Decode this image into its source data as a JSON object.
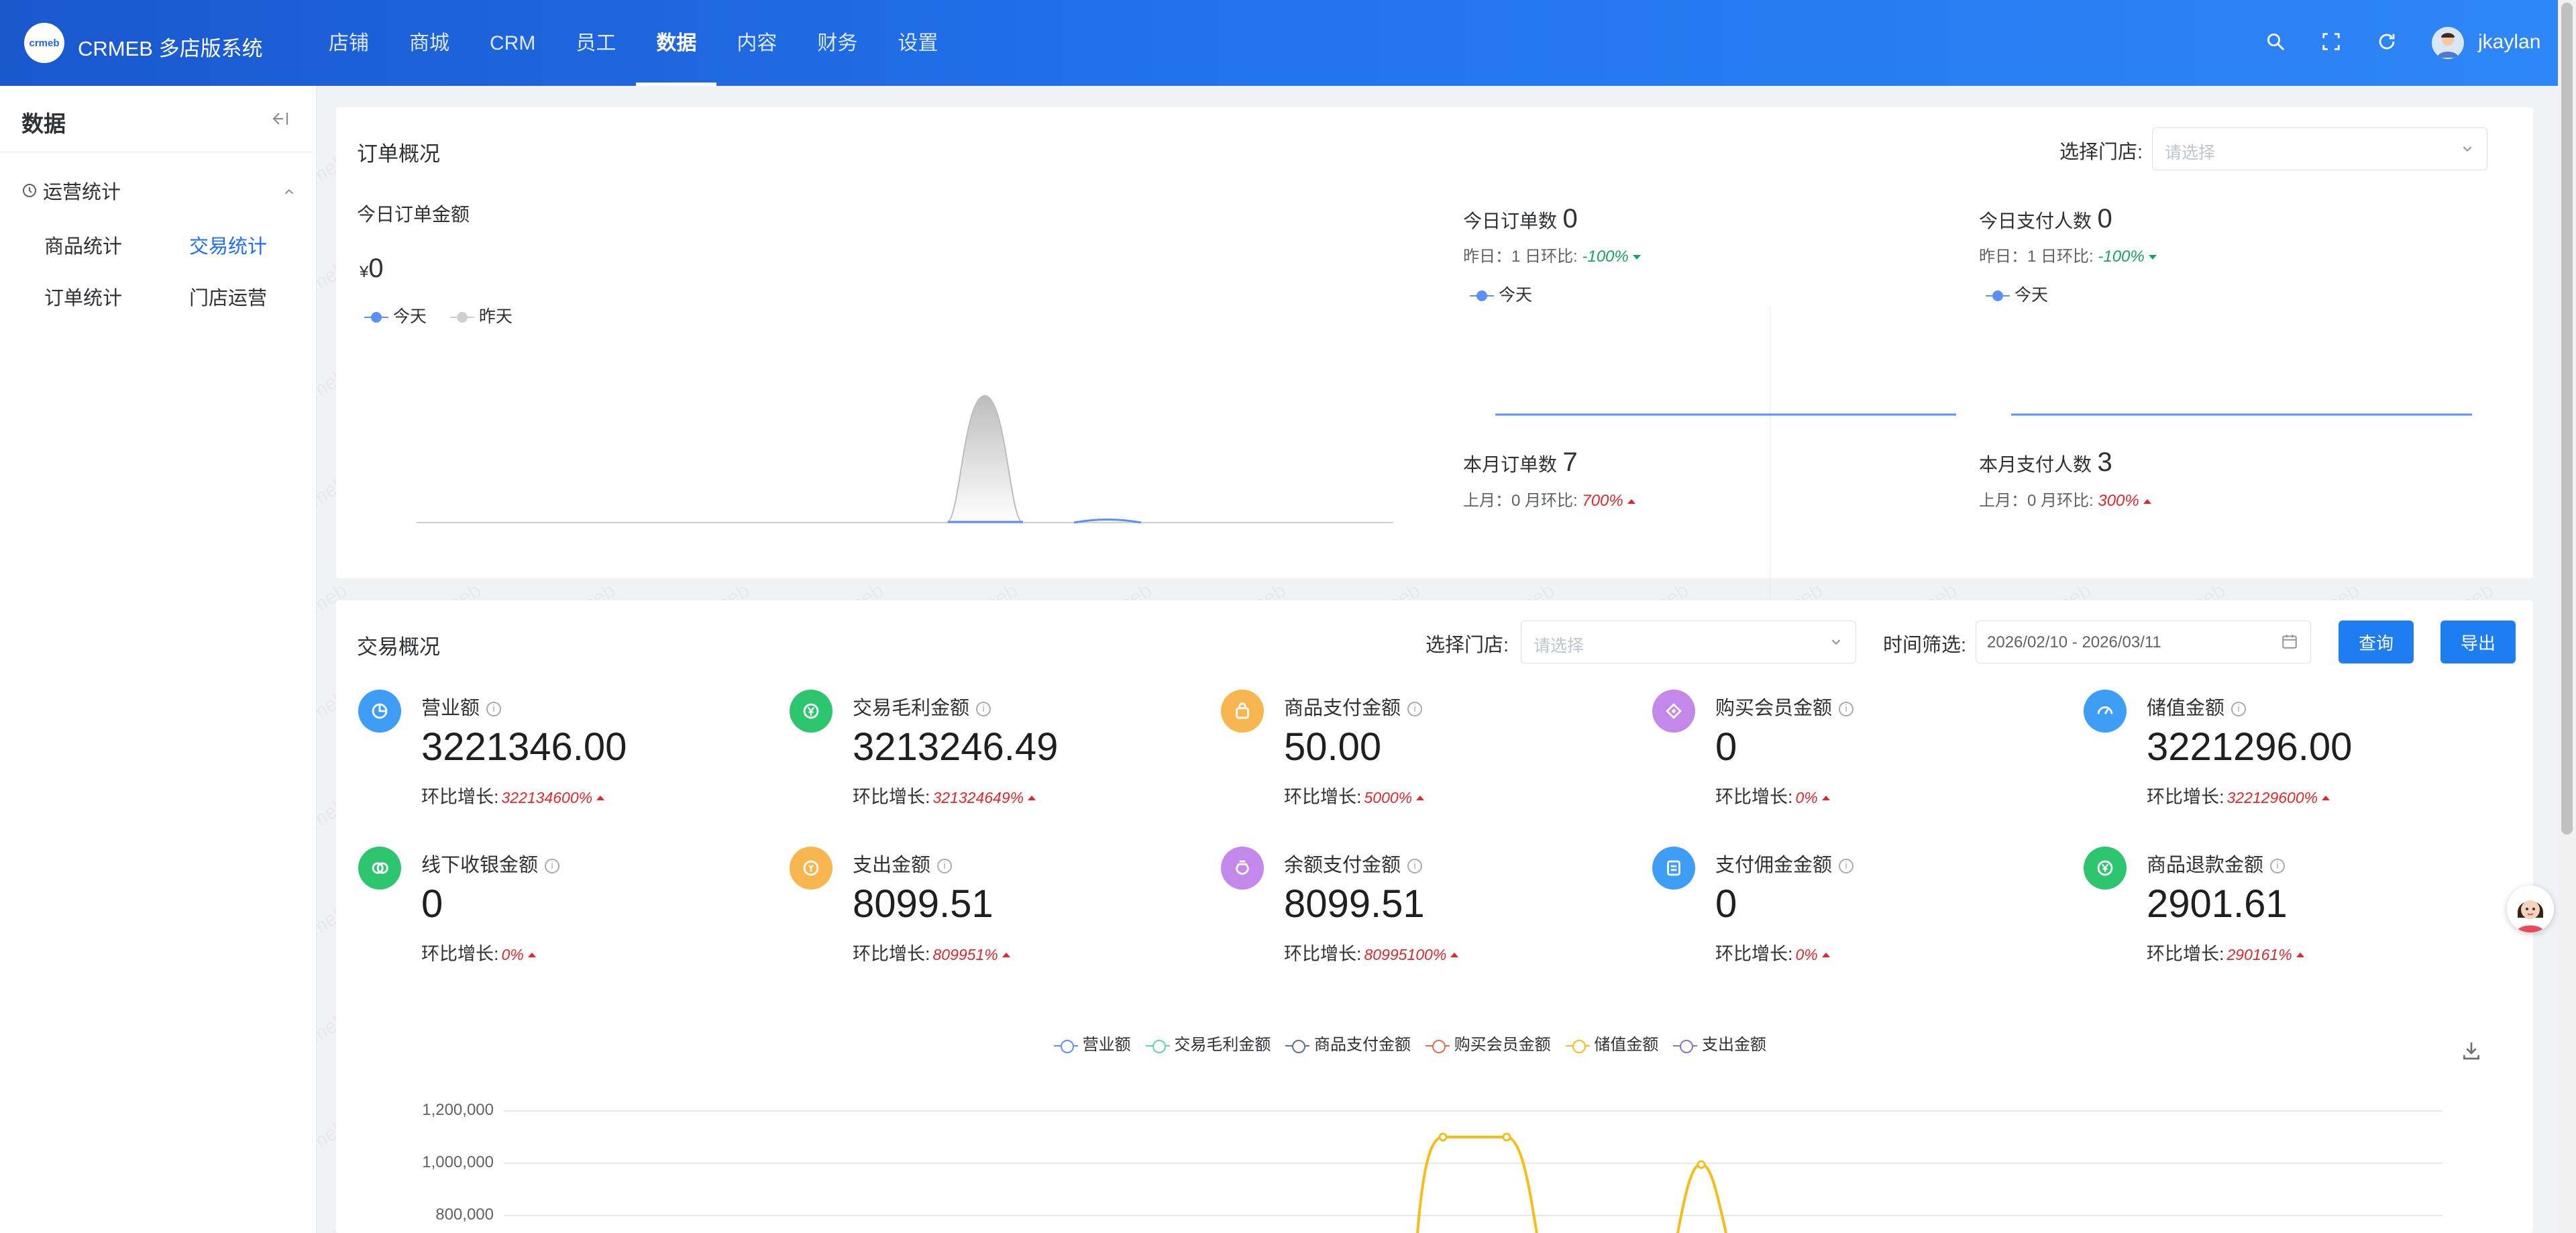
{
  "header": {
    "logo_text": "crmeb",
    "brand": "CRMEB 多店版系统",
    "nav": [
      "店铺",
      "商城",
      "CRM",
      "员工",
      "数据",
      "内容",
      "财务",
      "设置"
    ],
    "active_nav": "数据",
    "user": "jkaylan",
    "accent": "#2274ee"
  },
  "sidebar": {
    "title": "数据",
    "group": "运营统计",
    "items": [
      "商品统计",
      "交易统计",
      "订单统计",
      "门店运营"
    ],
    "active_item": "交易统计"
  },
  "order_overview": {
    "title": "订单概况",
    "store_label": "选择门店:",
    "store_placeholder": "请选择",
    "today_amount_label": "今日订单金额",
    "currency": "¥",
    "today_amount": "0",
    "legend_today": "今天",
    "legend_yesterday": "昨天",
    "today_orders_label": "今日订单数",
    "today_orders": "0",
    "today_orders_cmp": "昨日：1  日环比:",
    "today_orders_pct": "-100%",
    "today_payers_label": "今日支付人数",
    "today_payers": "0",
    "today_payers_cmp": "昨日：1  日环比:",
    "today_payers_pct": "-100%",
    "month_orders_label": "本月订单数",
    "month_orders": "7",
    "month_orders_cmp": "上月：0  月环比:",
    "month_orders_pct": "700%",
    "month_payers_label": "本月支付人数",
    "month_payers": "3",
    "month_payers_cmp": "上月：0  月环比:",
    "month_payers_pct": "300%"
  },
  "trade_overview": {
    "title": "交易概况",
    "store_label": "选择门店:",
    "store_placeholder": "请选择",
    "date_label": "时间筛选:",
    "date_range": "2026/02/10 - 2026/03/11",
    "query_button": "查询",
    "export_button": "导出",
    "change_label": "环比增长:",
    "metrics": [
      {
        "name": "营业额",
        "value": "3221346.00",
        "pct": "322134600%",
        "icon": "pie-chart-icon",
        "color": "#3e9df5"
      },
      {
        "name": "交易毛利金额",
        "value": "3213246.49",
        "pct": "321324649%",
        "icon": "yen-coin-icon",
        "color": "#2ec56f"
      },
      {
        "name": "商品支付金额",
        "value": "50.00",
        "pct": "5000%",
        "icon": "bag-icon",
        "color": "#f8b64e"
      },
      {
        "name": "购买会员金额",
        "value": "0",
        "pct": "0%",
        "icon": "member-diamond-icon",
        "color": "#c388ea"
      },
      {
        "name": "储值金额",
        "value": "3221296.00",
        "pct": "322129600%",
        "icon": "gauge-icon",
        "color": "#3e9df5"
      },
      {
        "name": "线下收银金额",
        "value": "0",
        "pct": "0%",
        "icon": "cashier-icon",
        "color": "#2ec56f"
      },
      {
        "name": "支出金额",
        "value": "8099.51",
        "pct": "809951%",
        "icon": "expense-coin-icon",
        "color": "#f8b64e"
      },
      {
        "name": "余额支付金额",
        "value": "8099.51",
        "pct": "80995100%",
        "icon": "money-bag-icon",
        "color": "#c388ea"
      },
      {
        "name": "支付佣金金额",
        "value": "0",
        "pct": "0%",
        "icon": "commission-icon",
        "color": "#3e9df5"
      },
      {
        "name": "商品退款金额",
        "value": "2901.61",
        "pct": "290161%",
        "icon": "refund-yen-icon",
        "color": "#2ec56f"
      }
    ]
  },
  "chart_data": {
    "type": "line",
    "series": [
      {
        "name": "营业额",
        "color": "#5b8ff9"
      },
      {
        "name": "交易毛利金额",
        "color": "#5ad8a6"
      },
      {
        "name": "商品支付金额",
        "color": "#5d7092"
      },
      {
        "name": "购买会员金额",
        "color": "#e8684a"
      },
      {
        "name": "储值金额",
        "color": "#f6bd16"
      },
      {
        "name": "支出金额",
        "color": "#9270ca"
      }
    ],
    "y_ticks": [
      "1,200,000",
      "1,000,000",
      "800,000"
    ],
    "ylim": [
      800000,
      1200000
    ],
    "legend_position": "top"
  }
}
